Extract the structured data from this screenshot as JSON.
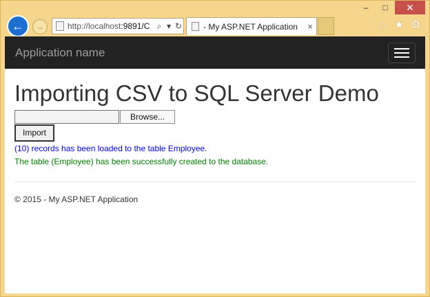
{
  "browser": {
    "address_url_host": "http://localhost",
    "address_url_rest": ":9891/C",
    "search_glyph": "⌕",
    "dropdown_glyph": "▾",
    "refresh_glyph": "↻",
    "tab_title": "- My ASP.NET Application",
    "tab_close": "×",
    "back_glyph": "←",
    "forward_glyph": "→",
    "caption_minimize": "–",
    "caption_maximize": "□",
    "caption_close": "✕",
    "home_glyph": "⌂",
    "favorites_glyph": "★",
    "settings_glyph": "⚙"
  },
  "navbar": {
    "brand": "Application name"
  },
  "main": {
    "heading": "Importing CSV to SQL Server Demo",
    "browse_label": "Browse...",
    "import_label": "Import",
    "message_loaded": "(10) records has been loaded to the table Employee.",
    "message_created": "The table (Employee) has been successfully created to the database."
  },
  "footer": {
    "text": "© 2015 - My ASP.NET Application"
  },
  "colors": {
    "navbar_bg": "#222222",
    "loaded_msg": "#0000ff",
    "created_msg": "#008000",
    "back_button": "#1d6fd1"
  }
}
